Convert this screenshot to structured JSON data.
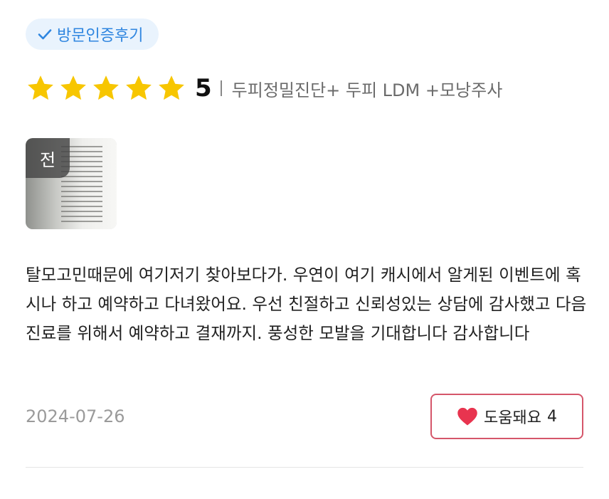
{
  "badge": {
    "label": "방문인증후기",
    "icon": "check-icon",
    "color": "#2f86e0"
  },
  "rating": {
    "stars": 5,
    "star_color": "#f7c600",
    "score": "5",
    "treatment": "두피정밀진단+ 두피 LDM +모낭주사"
  },
  "photo": {
    "label": "전"
  },
  "review": {
    "text": "탈모고민때문에 여기저기 찾아보다가. 우연이 여기 캐시에서 알게된 이벤트에 혹시나 하고 예약하고 다녀왔어요. 우선 친절하고 신뢰성있는 상담에 감사했고 다음 진료를 위해서 예약하고 결재까지. 풍성한 모발을 기대합니다 감사합니다"
  },
  "date": "2024-07-26",
  "helpful": {
    "label": "도움돼요",
    "count": "4",
    "icon": "heart-icon",
    "color": "#e8344f"
  }
}
